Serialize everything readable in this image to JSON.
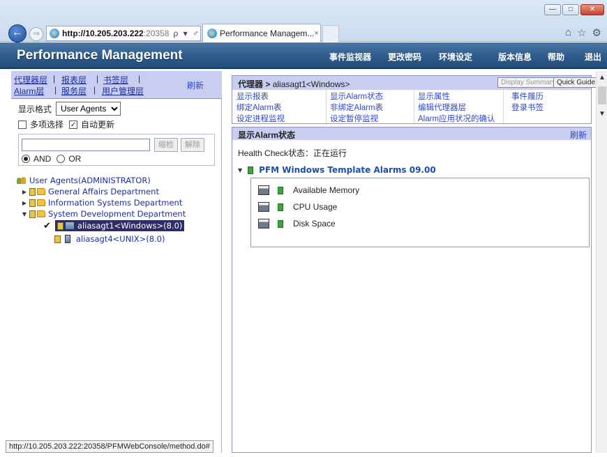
{
  "browser": {
    "address_host": "http://10.205.203.222",
    "address_rest": ":20358",
    "address_tools": "ρ ▾ ♂",
    "tab_title": "Performance Managem...",
    "tab_close": "×",
    "win_min": "—",
    "win_max": "□",
    "win_close": "✕",
    "icons": [
      "home-icon",
      "star-icon",
      "gear-icon"
    ]
  },
  "app": {
    "title": "Performance Management",
    "menu": [
      "事件监视器",
      "更改密码",
      "环境设定",
      "版本信息",
      "帮助",
      "退出"
    ]
  },
  "left": {
    "tabs_row1": [
      "代理器层",
      "报表层",
      "书签层"
    ],
    "tabs_row2": [
      "Alarm层",
      "服务层",
      "用户管理层"
    ],
    "refresh": "刷新",
    "format_label": "显示格式",
    "format_value": "User Agents",
    "multi_select": "多项选择",
    "auto_update": "自动更新",
    "filter_btn": "缩检",
    "release_btn": "解除",
    "and_label": "AND",
    "or_label": "OR",
    "tree": {
      "root": "User Agents(ADMINISTRATOR)",
      "folders": [
        "General Affairs Department",
        "Information Systems Department",
        "System Development Department"
      ],
      "agent1": "aliasagt1<Windows>(8.0)",
      "agent2": "aliasagt4<UNIX>(8.0)",
      "checkmark": "✔"
    }
  },
  "right": {
    "breadcrumb_root": "代理器",
    "breadcrumb_sep": " > ",
    "breadcrumb_agent": "aliasagt1<Windows>",
    "display_summary": "Display Summary",
    "quick_guide": "Quick Guide",
    "menu_col1": [
      "显示报表",
      "绑定Alarm表",
      "设定进程监视"
    ],
    "menu_col2": [
      "显示Alarm状态",
      "非绑定Alarm表",
      "设定暂停监视"
    ],
    "menu_col3": [
      "显示属性",
      "编辑代理器层",
      "Alarm应用状况的确认"
    ],
    "menu_col4": [
      "事件履历",
      "登录书签"
    ],
    "alarm_section_title": "显示Alarm状态",
    "alarm_refresh": "刷新",
    "health_label": "Health Check状态：正在运行",
    "template_name": "PFM Windows Template Alarms 09.00",
    "alarms": [
      "Available Memory",
      "CPU Usage",
      "Disk Space"
    ]
  },
  "status_bar": "http://10.205.203.222:20358/PFMWebConsole/method.do#"
}
